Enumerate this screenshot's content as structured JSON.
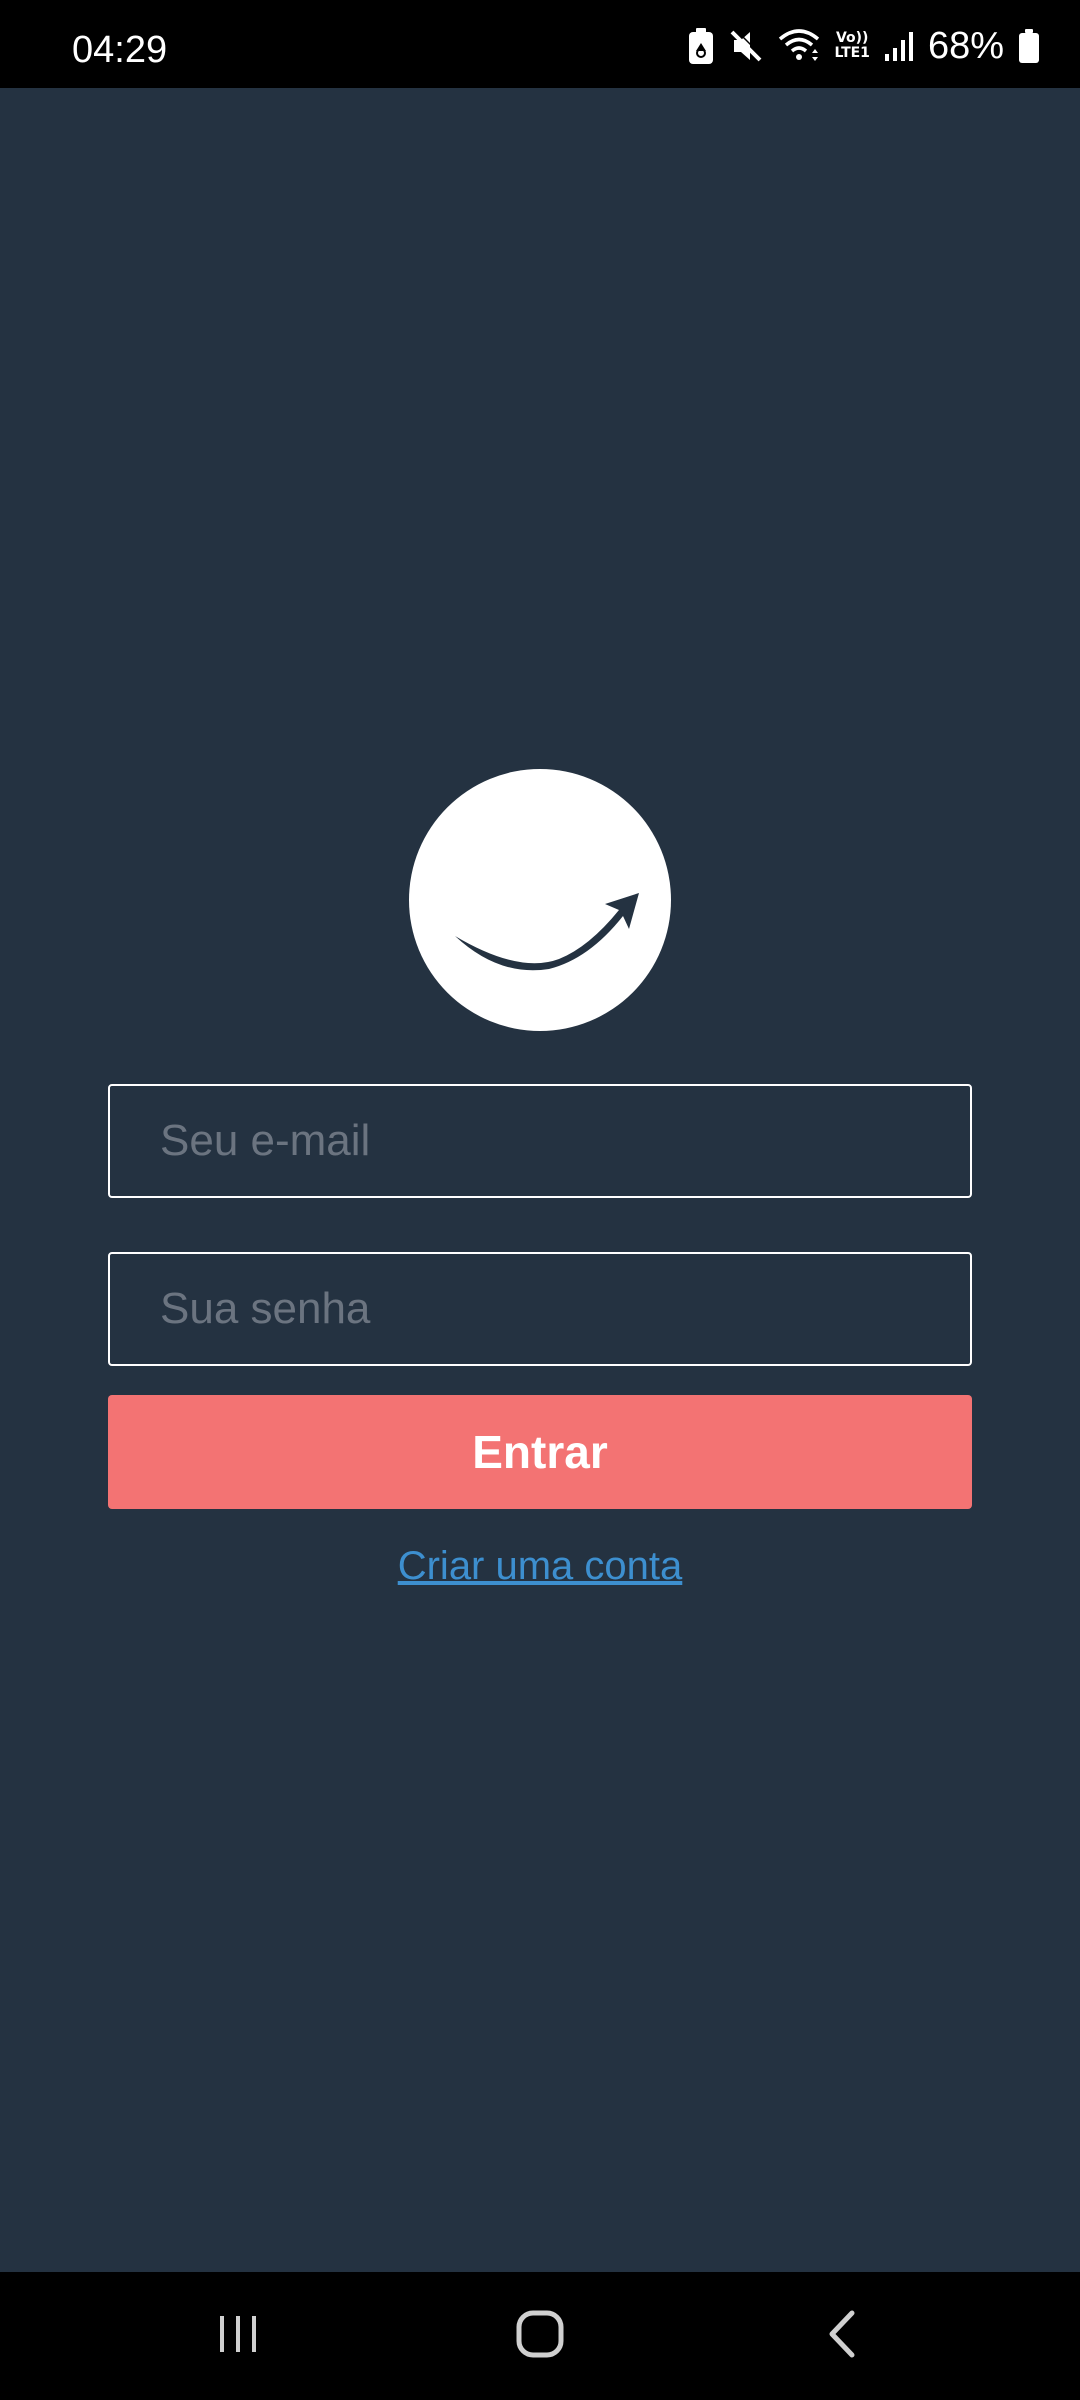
{
  "status_bar": {
    "time": "04:29",
    "battery_percent": "68%",
    "network_label_top": "Vo))",
    "network_label_bottom": "LTE1",
    "icons": [
      "battery-saver-icon",
      "mute-icon",
      "wifi-icon",
      "volte-lte-icon",
      "signal-icon",
      "battery-icon"
    ]
  },
  "login": {
    "logo_icon": "smile-arrow-logo-icon",
    "email_placeholder": "Seu e-mail",
    "email_value": "",
    "password_placeholder": "Sua senha",
    "password_value": "",
    "submit_label": "Entrar",
    "create_account_label": "Criar uma conta"
  },
  "nav_bar": {
    "icons": [
      "recent-apps-icon",
      "home-icon",
      "back-icon"
    ]
  },
  "colors": {
    "background": "#243241",
    "accent_button": "#f37373",
    "link": "#3d8fcf",
    "bars": "#000000"
  }
}
